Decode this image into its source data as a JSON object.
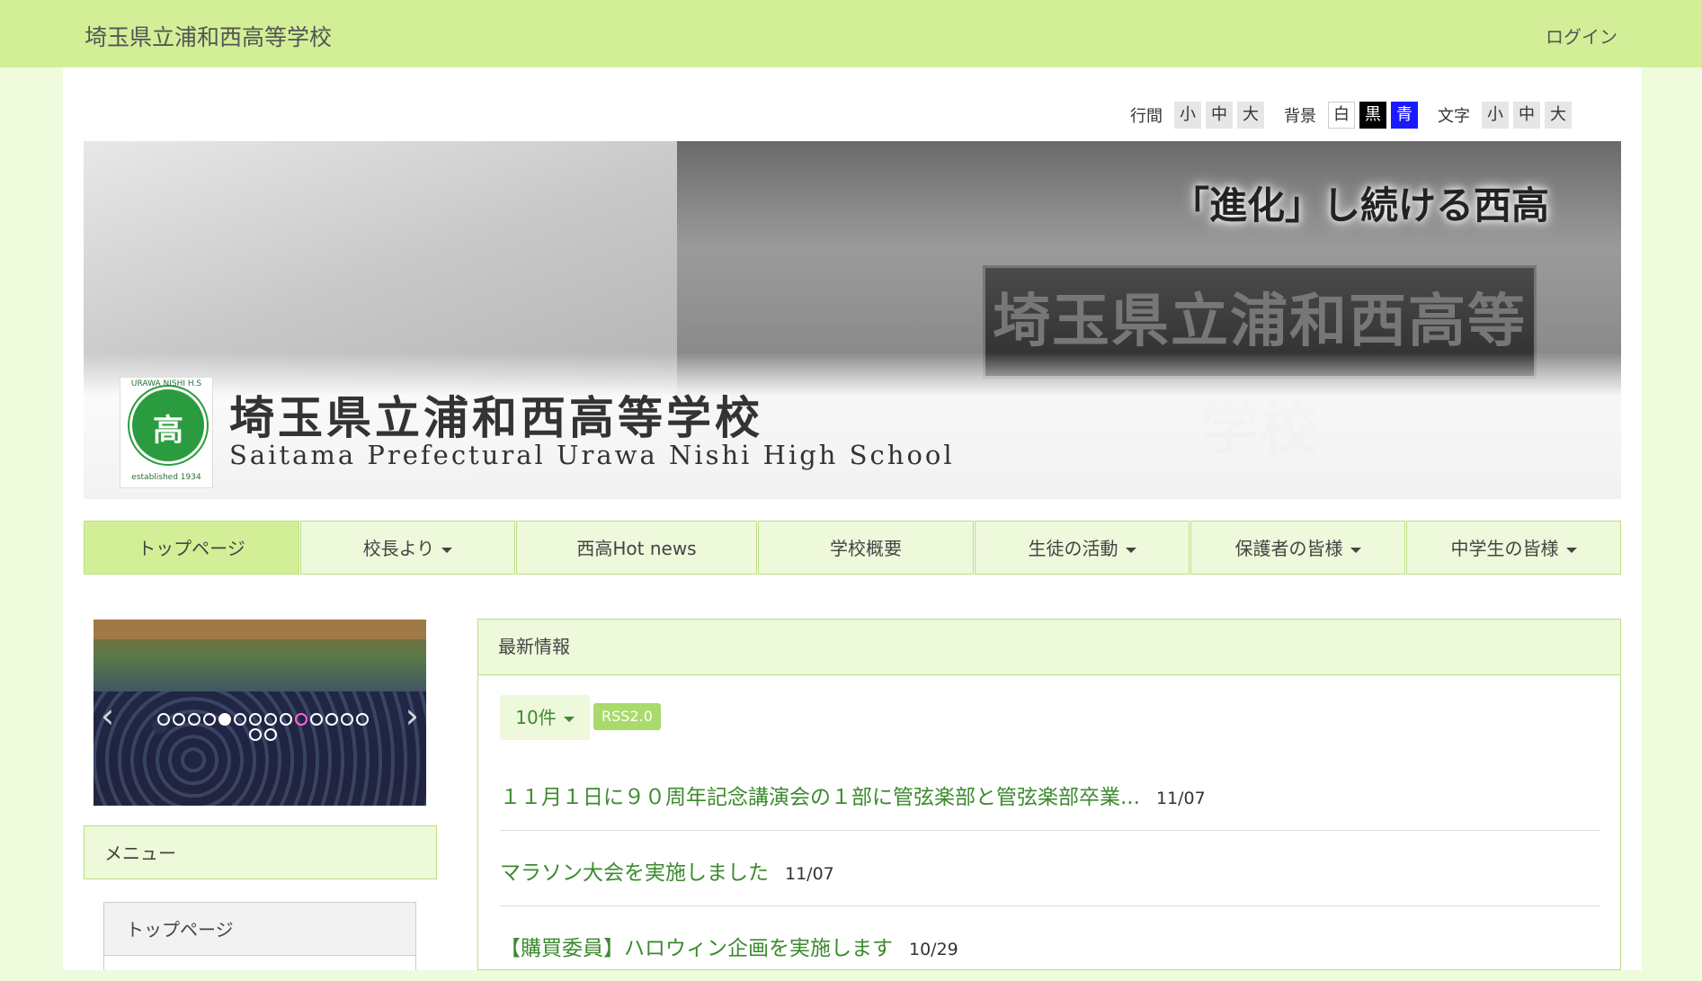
{
  "header": {
    "site_title": "埼玉県立浦和西高等学校",
    "login_label": "ログイン"
  },
  "accessibility": {
    "line_spacing": {
      "label": "行間",
      "options": [
        "小",
        "中",
        "大"
      ]
    },
    "background": {
      "label": "背景",
      "options": [
        "白",
        "黒",
        "青"
      ]
    },
    "text_size": {
      "label": "文字",
      "options": [
        "小",
        "中",
        "大"
      ]
    }
  },
  "banner": {
    "slogan": "「進化」し続ける西高",
    "plate_text": "埼玉県立浦和西高等学校",
    "school_name_jp": "埼玉県立浦和西高等学校",
    "school_name_en": "Saitama Prefectural Urawa Nishi High School",
    "emblem_top": "URAWA NISHI H.S",
    "emblem_mark": "高",
    "emblem_est": "established 1934"
  },
  "nav": {
    "items": [
      {
        "label": "トップページ",
        "dropdown": false,
        "active": true
      },
      {
        "label": "校長より",
        "dropdown": true,
        "active": false
      },
      {
        "label": "西高Hot news",
        "dropdown": false,
        "active": false
      },
      {
        "label": "学校概要",
        "dropdown": false,
        "active": false
      },
      {
        "label": "生徒の活動",
        "dropdown": true,
        "active": false
      },
      {
        "label": "保護者の皆様",
        "dropdown": true,
        "active": false
      },
      {
        "label": "中学生の皆様",
        "dropdown": true,
        "active": false
      }
    ]
  },
  "sidebar": {
    "menu_title": "メニュー",
    "menu_items": [
      "トップページ"
    ],
    "slider": {
      "slide_count": 16,
      "active_index": 4
    }
  },
  "news": {
    "title": "最新情報",
    "count_label": "10件",
    "rss_label": "RSS2.0",
    "items": [
      {
        "title": "１１月１日に９０周年記念講演会の１部に管弦楽部と管弦楽部卒業...",
        "date": "11/07"
      },
      {
        "title": "マラソン大会を実施しました",
        "date": "11/07"
      },
      {
        "title": "【購買委員】ハロウィン企画を実施します",
        "date": "10/29"
      }
    ]
  },
  "colors": {
    "accent": "#d2ef97",
    "link": "#3c8a2e",
    "nav_bg": "#eef8da",
    "border": "#b9df83"
  }
}
